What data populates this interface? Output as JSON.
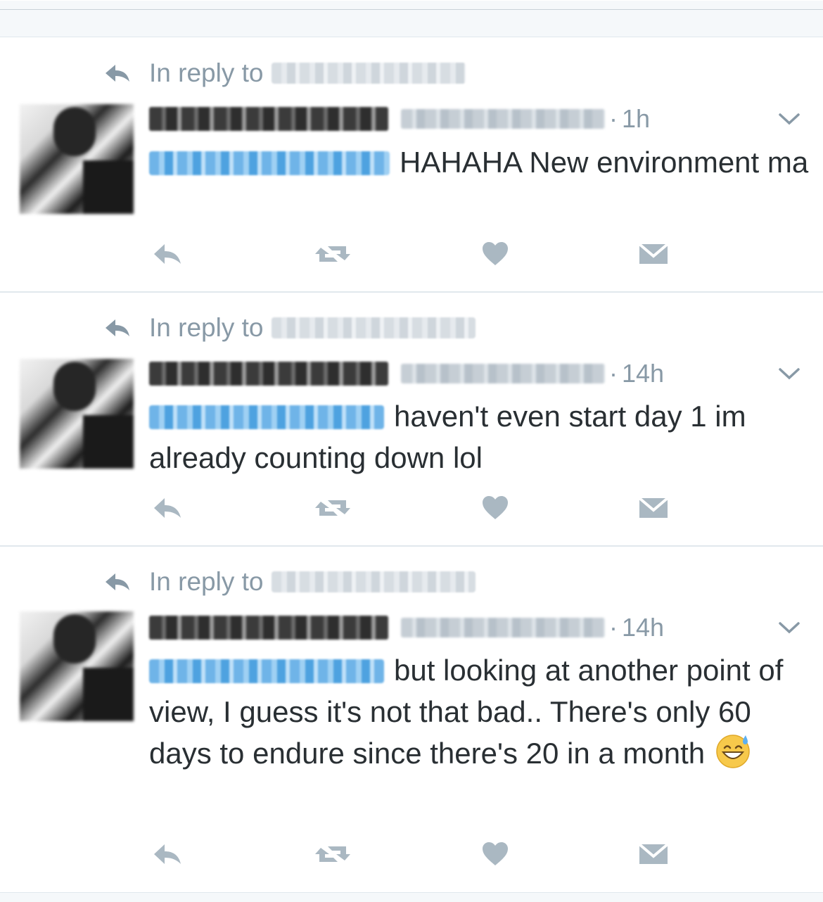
{
  "reply_prefix": "In reply to",
  "tweets": [
    {
      "time": "1h",
      "text": "HAHAHA New environment ma"
    },
    {
      "time": "14h",
      "text": "haven't even start day 1 im already counting down lol"
    },
    {
      "time": "14h",
      "text": "but looking at another point of view, I guess it's not that bad.. There's only 60 days to endure since there's 20 in a month",
      "emoji": "😅"
    }
  ],
  "separator": "·",
  "icons": {
    "reply_context": "reply-arrow-icon",
    "menu": "chevron-down-icon",
    "actions": [
      "reply-icon",
      "retweet-icon",
      "like-icon",
      "direct-message-icon"
    ]
  },
  "colors": {
    "text": "#292f33",
    "muted": "#8899a6",
    "action_icon": "#aab8c2",
    "mention": "#1da1f2",
    "divider": "#e1e8ed"
  }
}
